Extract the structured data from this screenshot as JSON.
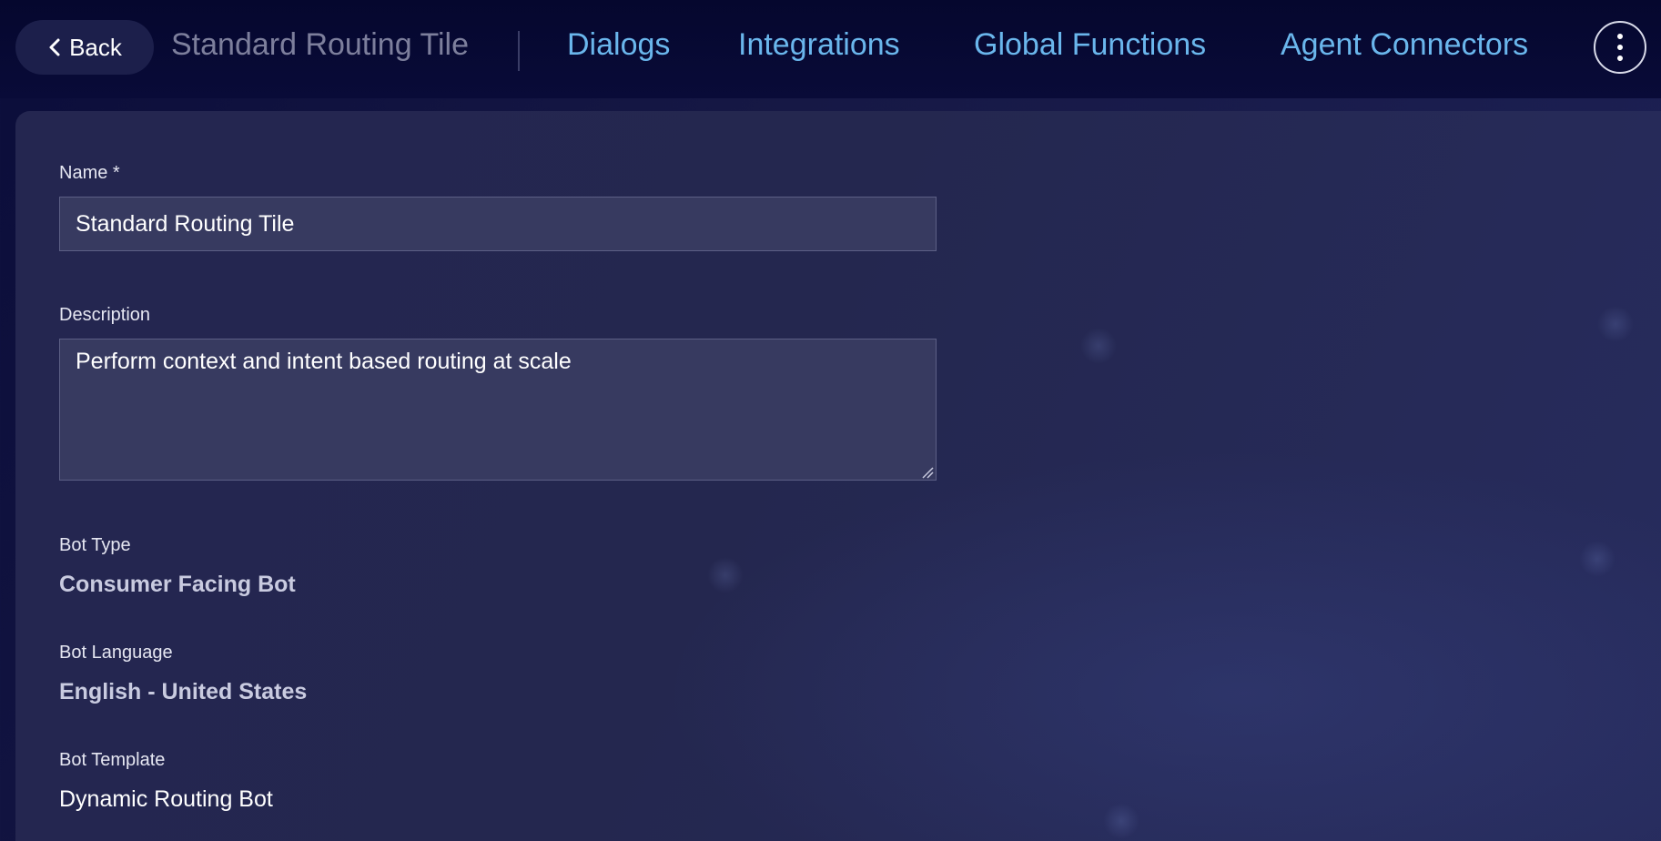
{
  "header": {
    "back_label": "Back",
    "bot_title": "Standard Routing Tile",
    "nav": {
      "dialogs": "Dialogs",
      "integrations": "Integrations",
      "global_functions": "Global Functions",
      "agent_connectors": "Agent Connectors"
    },
    "more_icon": "vertical-ellipsis-icon",
    "back_icon": "chevron-left-icon"
  },
  "form": {
    "name": {
      "label": "Name *",
      "value": "Standard Routing Tile"
    },
    "description": {
      "label": "Description",
      "value": "Perform context and intent based routing at scale"
    },
    "bot_type": {
      "label": "Bot Type",
      "value": "Consumer Facing Bot"
    },
    "bot_language": {
      "label": "Bot Language",
      "value": "English - United States"
    },
    "bot_template": {
      "label": "Bot Template",
      "value": "Dynamic Routing Bot"
    }
  },
  "colors": {
    "header_bg": "#05072e",
    "panel_bg": "#24274f",
    "nav_link": "#6ab6ec",
    "input_bg": "#373a60"
  }
}
